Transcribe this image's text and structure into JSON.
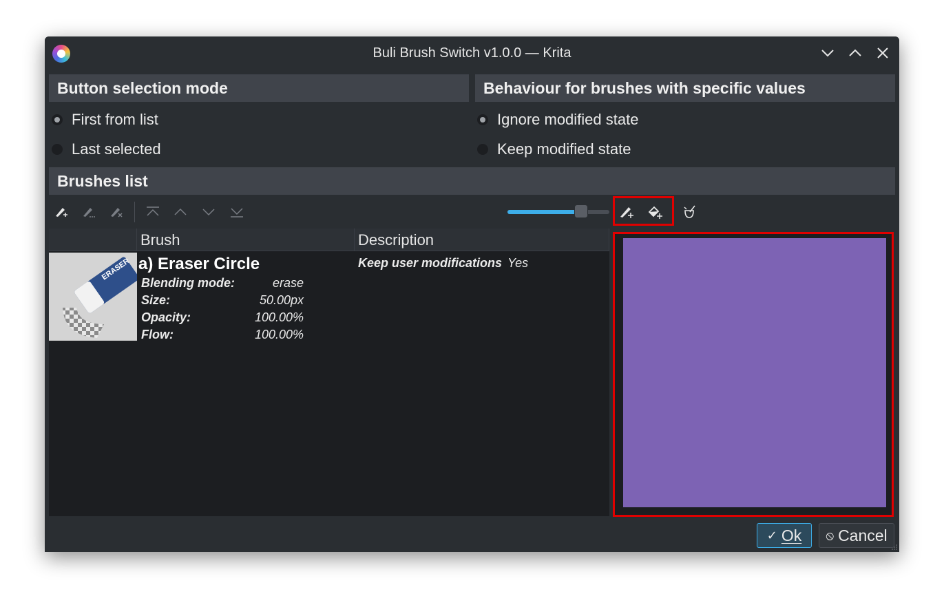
{
  "window": {
    "title": "Buli Brush Switch v1.0.0 — Krita",
    "minimize_icon": "chevron-down-icon",
    "maximize_icon": "chevron-up-icon",
    "close_icon": "close-icon"
  },
  "selection_mode": {
    "header": "Button selection mode",
    "options": [
      {
        "label": "First from list",
        "checked": true
      },
      {
        "label": "Last selected",
        "checked": false
      }
    ]
  },
  "behaviour": {
    "header": "Behaviour for brushes with specific values",
    "options": [
      {
        "label": "Ignore modified state",
        "checked": true
      },
      {
        "label": "Keep modified state",
        "checked": false
      }
    ]
  },
  "brushes_list": {
    "header": "Brushes list",
    "toolbar": {
      "icons": [
        "add-brush-icon",
        "edit-brush-icon",
        "remove-brush-icon",
        "move-first-icon",
        "move-up-icon",
        "move-down-icon",
        "move-last-icon"
      ],
      "right_icons": [
        "brush-plus-icon",
        "fill-plus-icon",
        "clear-icon"
      ],
      "zoom_level_fraction": 0.72
    },
    "columns": [
      "Brush",
      "Description"
    ],
    "rows": [
      {
        "name": "a) Eraser Circle",
        "thumbnail_text": "ERASER",
        "properties": [
          {
            "key": "Blending mode:",
            "value": "erase"
          },
          {
            "key": "Size:",
            "value": "50.00px"
          },
          {
            "key": "Opacity:",
            "value": "100.00%"
          },
          {
            "key": "Flow:",
            "value": "100.00%"
          }
        ],
        "description": {
          "key": "Keep user modifications",
          "value": "Yes"
        }
      }
    ]
  },
  "preview": {
    "color": "#7d63b4"
  },
  "buttons": {
    "ok": "Ok",
    "cancel": "Cancel"
  },
  "colors": {
    "accent": "#3daee9",
    "highlight_border": "#e00000"
  }
}
